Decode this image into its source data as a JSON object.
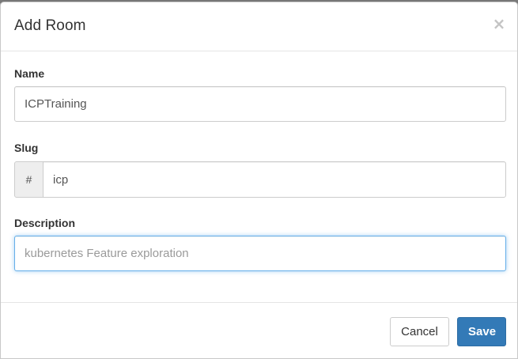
{
  "dialog": {
    "title": "Add Room",
    "close_label": "×"
  },
  "form": {
    "name": {
      "label": "Name",
      "value": "ICPTraining",
      "placeholder": ""
    },
    "slug": {
      "label": "Slug",
      "prefix": "#",
      "value": "icp",
      "placeholder": ""
    },
    "description": {
      "label": "Description",
      "value": "",
      "placeholder": "kubernetes Feature exploration"
    }
  },
  "footer": {
    "cancel_label": "Cancel",
    "save_label": "Save"
  },
  "colors": {
    "primary": "#337ab7",
    "focus_ring": "#66afe9",
    "addon_bg": "#eeeeee"
  }
}
